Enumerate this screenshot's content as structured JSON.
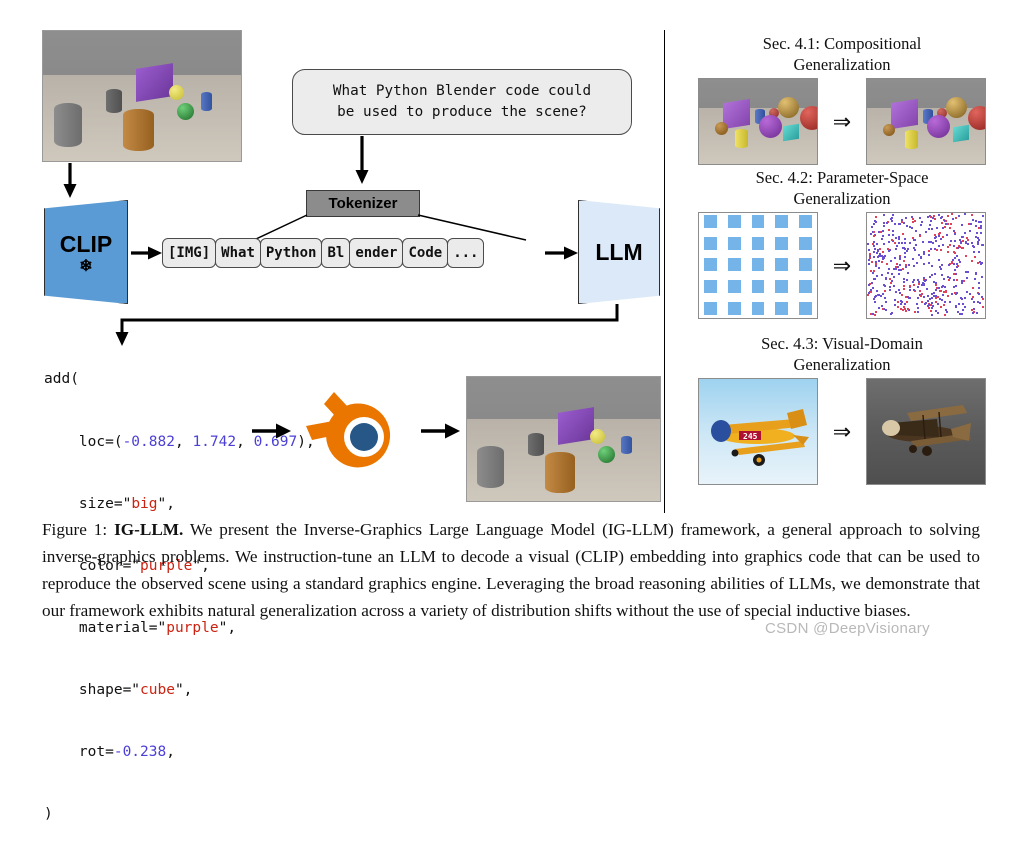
{
  "figure": {
    "caption_label": "Figure 1:",
    "caption_bold": "IG-LLM.",
    "caption_body": " We present the Inverse-Graphics Large Language Model (IG-LLM) framework, a general approach to solving inverse-graphics problems.  We instruction-tune an LLM to decode a visual (CLIP) embedding into graphics code that can be used to reproduce the observed scene using a standard graphics engine.  Leveraging the broad reasoning abilities of LLMs, we demonstrate that our framework exhibits natural generalization across a variety of distribution shifts without the use of special inductive biases."
  },
  "watermark": "CSDN @DeepVisionary",
  "prompt": {
    "text": "What Python Blender code could\nbe used to produce the scene?"
  },
  "encoder": {
    "clip_label": "CLIP",
    "frozen_icon": "❄"
  },
  "decoder": {
    "llm_label": "LLM"
  },
  "tokenizer": {
    "label": "Tokenizer",
    "tokens": [
      "[IMG]",
      "What",
      "Python",
      "Bl",
      "ender",
      "Code",
      "..."
    ]
  },
  "code": {
    "lines": [
      {
        "segments": [
          {
            "t": "add(",
            "c": "plain"
          }
        ]
      },
      {
        "segments": [
          {
            "t": "    loc=(",
            "c": "plain"
          },
          {
            "t": "-0.882",
            "c": "num"
          },
          {
            "t": ", ",
            "c": "plain"
          },
          {
            "t": "1.742",
            "c": "num"
          },
          {
            "t": ", ",
            "c": "plain"
          },
          {
            "t": "0.697",
            "c": "num"
          },
          {
            "t": "),",
            "c": "plain"
          }
        ]
      },
      {
        "segments": [
          {
            "t": "    size=\"",
            "c": "plain"
          },
          {
            "t": "big",
            "c": "str"
          },
          {
            "t": "\",",
            "c": "plain"
          }
        ]
      },
      {
        "segments": [
          {
            "t": "    color=\"",
            "c": "plain"
          },
          {
            "t": "purple",
            "c": "str"
          },
          {
            "t": "\",",
            "c": "plain"
          }
        ]
      },
      {
        "segments": [
          {
            "t": "    material=\"",
            "c": "plain"
          },
          {
            "t": "purple",
            "c": "str"
          },
          {
            "t": "\",",
            "c": "plain"
          }
        ]
      },
      {
        "segments": [
          {
            "t": "    shape=\"",
            "c": "plain"
          },
          {
            "t": "cube",
            "c": "str"
          },
          {
            "t": "\",",
            "c": "plain"
          }
        ]
      },
      {
        "segments": [
          {
            "t": "    rot=",
            "c": "plain"
          },
          {
            "t": "-0.238",
            "c": "num"
          },
          {
            "t": ",",
            "c": "plain"
          }
        ]
      },
      {
        "segments": [
          {
            "t": ")",
            "c": "plain"
          }
        ]
      }
    ],
    "number_color": "#4b3fd6",
    "string_color": "#cc2211"
  },
  "renderer": {
    "name": "blender-logo",
    "orange": "#ea7600",
    "blue": "#265787"
  },
  "sections": [
    {
      "id": "sec-4-1",
      "title": "Sec. 4.1: Compositional\nGeneralization",
      "arrow": "⇒",
      "left_caption": "",
      "right_caption": ""
    },
    {
      "id": "sec-4-2",
      "title": "Sec. 4.2: Parameter-Space\nGeneralization",
      "arrow": "⇒",
      "left_caption": "",
      "right_caption": ""
    },
    {
      "id": "sec-4-3",
      "title": "Sec. 4.3: Visual-Domain\nGeneralization",
      "arrow": "⇒",
      "left_caption": "",
      "right_caption": ""
    }
  ],
  "scene_objects": [
    {
      "shape": "cylinder",
      "color": "#7c7c7c",
      "size": "large",
      "name": "gray-cylinder-large"
    },
    {
      "shape": "cylinder",
      "color": "#6e6e6e",
      "size": "small",
      "name": "gray-cylinder-small"
    },
    {
      "shape": "cube",
      "color": "#8a4fbd",
      "size": "large",
      "name": "purple-cube"
    },
    {
      "shape": "sphere",
      "color": "#e0d84a",
      "size": "small",
      "name": "yellow-sphere"
    },
    {
      "shape": "cylinder",
      "color": "#3f62b5",
      "size": "small",
      "name": "blue-cylinder"
    },
    {
      "shape": "sphere",
      "color": "#2f8f3a",
      "size": "small",
      "name": "green-metal-sphere"
    },
    {
      "shape": "cylinder",
      "color": "#b07634",
      "size": "large",
      "name": "brown-cylinder"
    }
  ],
  "colors": {
    "clip_fill": "#5b9bd5",
    "llm_fill": "#dce9f8",
    "tokenizer_fill": "#8c8c8c",
    "token_fill": "#ebebeb",
    "prompt_fill": "#ececec",
    "grid_square": "#74b4e8",
    "scatter_purple": "#6a4fd0",
    "scatter_red": "#e0405a"
  }
}
